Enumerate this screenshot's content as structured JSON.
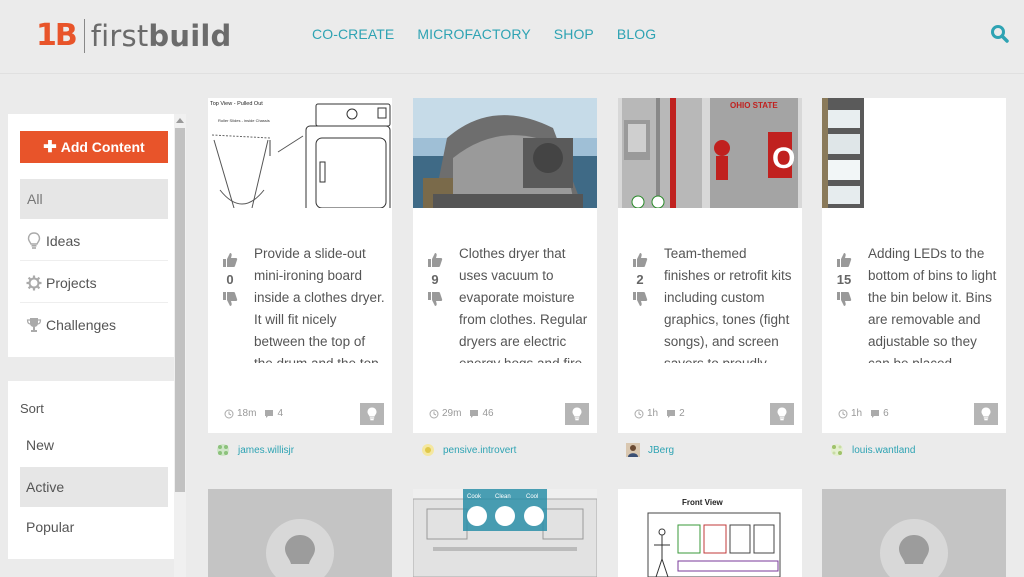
{
  "brand": {
    "mark": "1B",
    "name_light": "first",
    "name_bold": "build",
    "accent": "#e8542a",
    "link_color": "#2ea3b3"
  },
  "nav": [
    "CO-CREATE",
    "MICROFACTORY",
    "SHOP",
    "BLOG"
  ],
  "sidebar": {
    "add_label": "Add Content",
    "filters": [
      {
        "label": "All",
        "icon": "none",
        "active": true
      },
      {
        "label": "Ideas",
        "icon": "lightbulb-icon",
        "active": false
      },
      {
        "label": "Projects",
        "icon": "gear-icon",
        "active": false
      },
      {
        "label": "Challenges",
        "icon": "trophy-icon",
        "active": false
      }
    ],
    "sort_title": "Sort",
    "sort_options": [
      {
        "label": "New",
        "active": false
      },
      {
        "label": "Active",
        "active": true
      },
      {
        "label": "Popular",
        "active": false
      }
    ]
  },
  "cards": [
    {
      "votes": "0",
      "description": "Provide a slide-out mini-ironing board inside a clothes dryer. It will fit nicely between the top of the drum and the top",
      "time": "18m",
      "comments": "4",
      "author": "james.willisjr",
      "image_caption": "Top View - Pulled Out",
      "image_label": "Roller Slides - inside Chassis"
    },
    {
      "votes": "9",
      "description": "Clothes dryer that uses vacuum to evaporate moisture from clothes. Regular dryers are electric energy hogs and fire",
      "time": "29m",
      "comments": "46",
      "author": "pensive.introvert"
    },
    {
      "votes": "2",
      "description": "Team-themed finishes or retrofit kits including custom graphics, tones (fight songs), and screen savers to proudly",
      "time": "1h",
      "comments": "2",
      "author": "JBerg",
      "image_text": "OHIO STATE"
    },
    {
      "votes": "15",
      "description": "Adding LEDs to the bottom of bins to light the bin below it. Bins are removable and adjustable so they can be placed",
      "time": "1h",
      "comments": "6",
      "author": "louis.wantland"
    }
  ],
  "row2": {
    "panel_buttons": [
      "Cook",
      "Clean",
      "Cool"
    ],
    "front_view_label": "Front View"
  }
}
